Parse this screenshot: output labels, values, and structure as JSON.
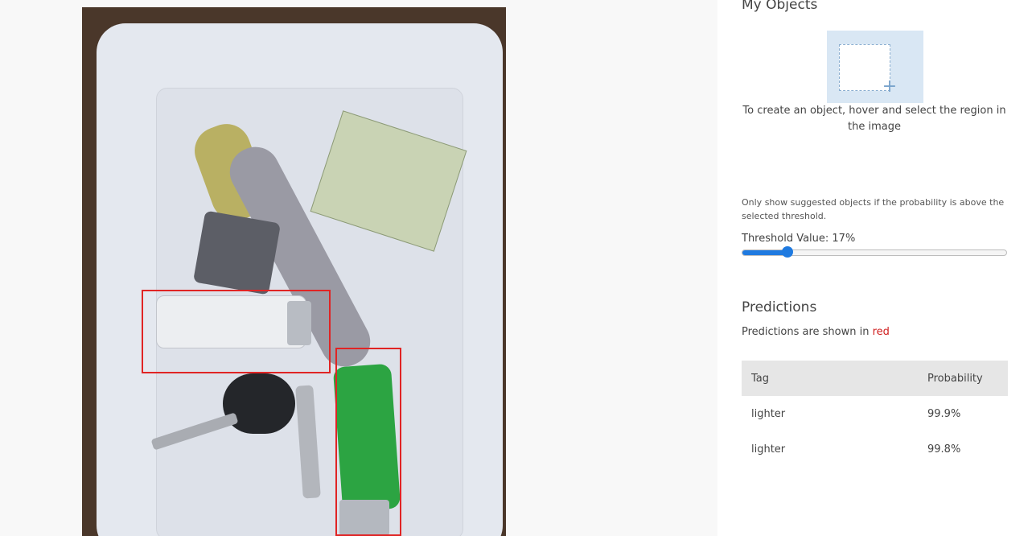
{
  "image": {
    "detections": [
      {
        "tag": "lighter",
        "probability": "99.9%"
      },
      {
        "tag": "lighter",
        "probability": "99.8%"
      }
    ],
    "box_color": "#e02424"
  },
  "objects_panel": {
    "title": "My Objects",
    "create_hint": "To create an object, hover and select the region in the image"
  },
  "threshold": {
    "hint": "Only show suggested objects if the probability is above the selected threshold.",
    "label": "Threshold Value: 17%",
    "value": 0.17,
    "accent_color": "#1f7ae0"
  },
  "predictions": {
    "title": "Predictions",
    "note_prefix": "Predictions are shown in ",
    "note_color_word": "red",
    "columns": [
      "Tag",
      "Probability"
    ],
    "rows": [
      {
        "tag": "lighter",
        "probability": "99.9%"
      },
      {
        "tag": "lighter",
        "probability": "99.8%"
      }
    ]
  }
}
